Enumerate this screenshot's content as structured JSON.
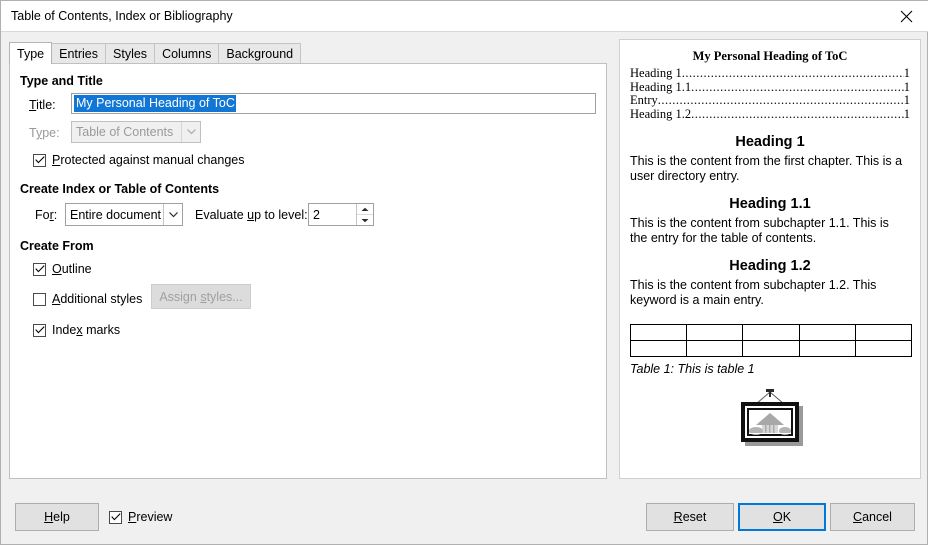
{
  "window": {
    "title": "Table of Contents, Index or Bibliography",
    "close_icon": "close-icon"
  },
  "tabs": [
    {
      "label": "Type",
      "active": true
    },
    {
      "label": "Entries",
      "active": false
    },
    {
      "label": "Styles",
      "active": false
    },
    {
      "label": "Columns",
      "active": false
    },
    {
      "label": "Background",
      "active": false
    }
  ],
  "type_and_title": {
    "group_label": "Type and Title",
    "title_label": "Title:",
    "title_value": "My Personal Heading of ToC",
    "title_selected": true,
    "type_label": "Type:",
    "type_value": "Table of Contents",
    "type_disabled": true,
    "protected_label": "Protected against manual changes",
    "protected_checked": true
  },
  "create_index": {
    "group_label": "Create Index or Table of Contents",
    "for_label": "For:",
    "for_value": "Entire document",
    "evaluate_label": "Evaluate up to level:",
    "evaluate_value": "2"
  },
  "create_from": {
    "group_label": "Create From",
    "outline_label": "Outline",
    "outline_checked": true,
    "additional_styles_label": "Additional styles",
    "additional_styles_checked": false,
    "assign_styles_label": "Assign styles...",
    "assign_styles_disabled": true,
    "index_marks_label": "Index marks",
    "index_marks_checked": true
  },
  "preview": {
    "toc_title": "My Personal Heading of ToC",
    "toc_entries": [
      {
        "label": "Heading 1",
        "page": "1"
      },
      {
        "label": "Heading 1.1",
        "page": "1"
      },
      {
        "label": "Entry",
        "page": "1"
      },
      {
        "label": "Heading 1.2",
        "page": "1"
      }
    ],
    "sections": [
      {
        "heading": "Heading 1",
        "body": "This is the content from the first chapter. This is a user directory entry."
      },
      {
        "heading": "Heading 1.1",
        "body": "This is the content from subchapter 1.1. This is the entry for the table of contents."
      },
      {
        "heading": "Heading 1.2",
        "body": "This is the content from subchapter 1.2. This keyword is a main entry."
      }
    ],
    "table": {
      "columns": 5,
      "rows": 2
    },
    "table_caption": "Table 1: This is table 1",
    "image_icon": "framed-picture-icon"
  },
  "footer": {
    "help_label": "Help",
    "preview_label": "Preview",
    "preview_checked": true,
    "reset_label": "Reset",
    "ok_label": "OK",
    "cancel_label": "Cancel"
  },
  "colors": {
    "selection_blue": "#1277d4",
    "focus_blue": "#0078d7",
    "dialog_bg": "#f0f0f0",
    "panel_bg": "#ffffff"
  }
}
